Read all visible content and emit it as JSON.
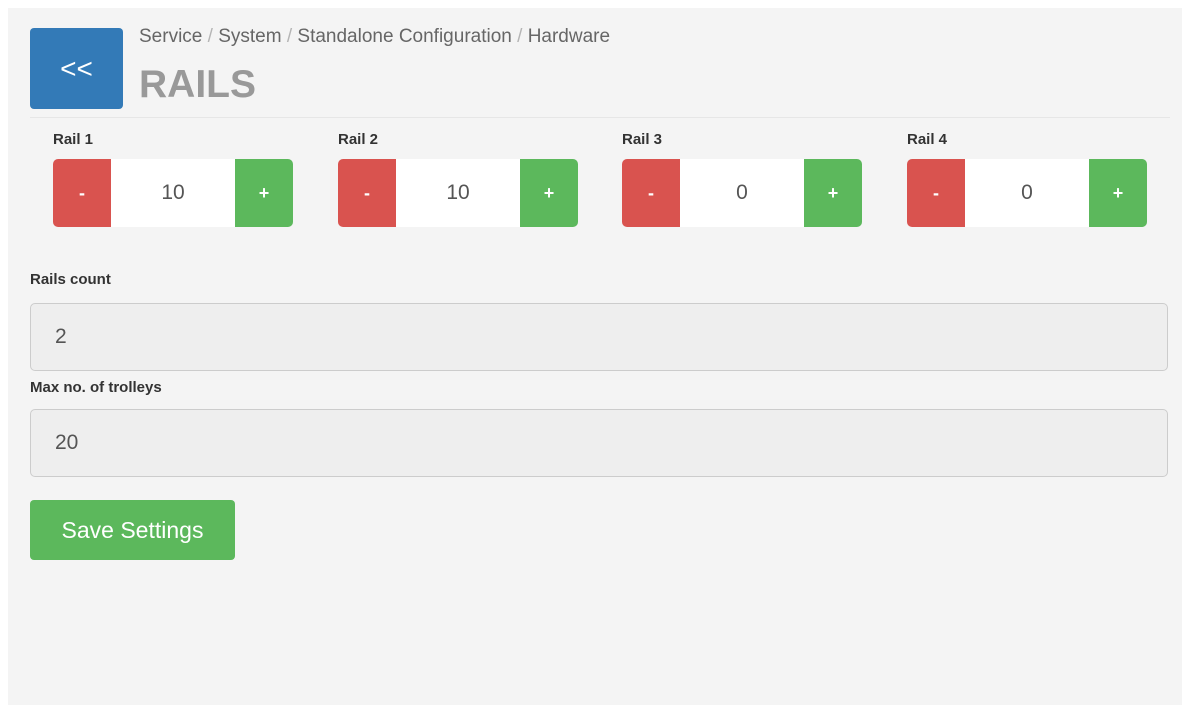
{
  "header": {
    "back_label": "<<",
    "breadcrumb": [
      "Service",
      "System",
      "Standalone Configuration",
      "Hardware"
    ],
    "breadcrumb_separator": "/",
    "title": "RAILS"
  },
  "rails": [
    {
      "label": "Rail 1",
      "value": "10",
      "minus_label": "-",
      "plus_label": "+"
    },
    {
      "label": "Rail 2",
      "value": "10",
      "minus_label": "-",
      "plus_label": "+"
    },
    {
      "label": "Rail 3",
      "value": "0",
      "minus_label": "-",
      "plus_label": "+"
    },
    {
      "label": "Rail 4",
      "value": "0",
      "minus_label": "-",
      "plus_label": "+"
    }
  ],
  "rails_count": {
    "label": "Rails count",
    "value": "2"
  },
  "max_trolleys": {
    "label": "Max no. of trolleys",
    "value": "20"
  },
  "save_label": "Save Settings",
  "colors": {
    "back": "#337ab7",
    "minus": "#d9534f",
    "plus": "#5cb85c",
    "save": "#5cb85c"
  }
}
